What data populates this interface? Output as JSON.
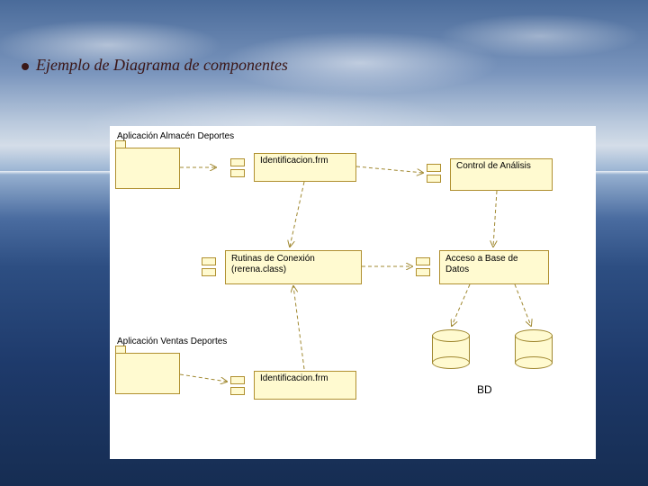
{
  "title": "Ejemplo de Diagrama de componentes",
  "diagram": {
    "package1_label": "Aplicación Almacén Deportes",
    "package2_label": "Aplicación Ventas Deportes",
    "comp_identificacion": "Identificacion.frm",
    "comp_control": "Control de Análisis",
    "comp_rutinas": "Rutinas de Conexión (rerena.class)",
    "comp_acceso": "Acceso a Base de Datos",
    "comp_identificacion2": "Identificacion.frm",
    "db_label": "BD"
  }
}
